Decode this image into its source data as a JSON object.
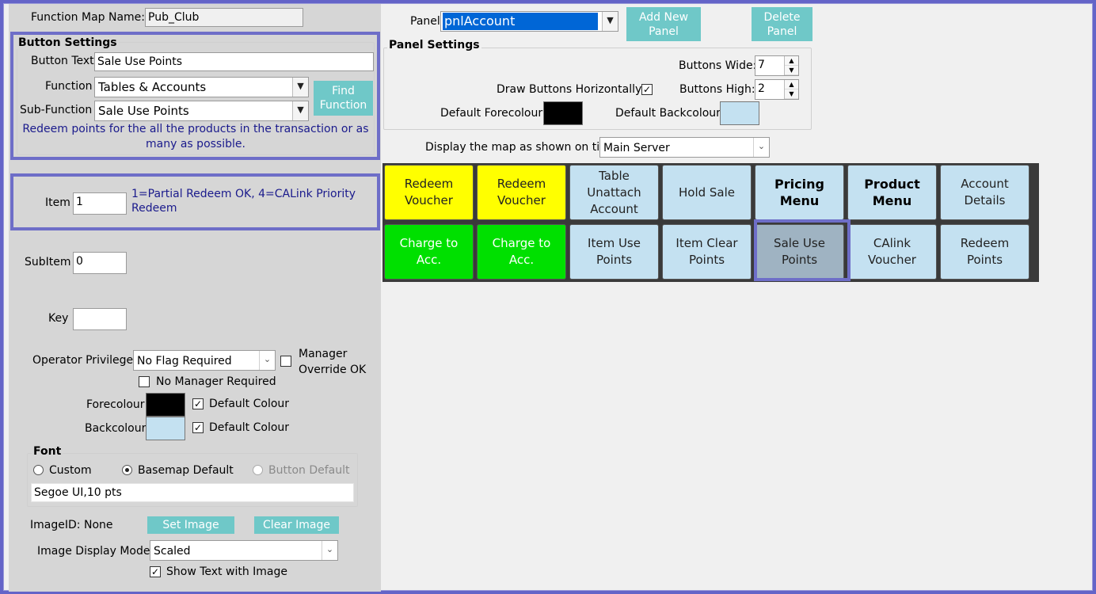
{
  "function_map": {
    "label": "Function Map Name:",
    "value": "Pub_Club"
  },
  "button_settings": {
    "title": "Button Settings",
    "button_text_label": "Button Text",
    "button_text_value": "Sale Use Points",
    "function_label": "Function",
    "function_value": "Tables & Accounts",
    "sub_function_label": "Sub-Function",
    "sub_function_value": "Sale Use Points",
    "find_function_label_1": "Find",
    "find_function_label_2": "Function",
    "description_1": "Redeem points for the all the products in the transaction or as",
    "description_2": "many as possible."
  },
  "item": {
    "label": "Item",
    "value": "1",
    "hint_1": "1=Partial Redeem OK, 4=CALink Priority",
    "hint_2": "Redeem"
  },
  "subitem": {
    "label": "SubItem",
    "value": "0"
  },
  "key": {
    "label": "Key",
    "value": ""
  },
  "operator": {
    "label": "Operator Privilege:",
    "value": "No Flag Required",
    "manager_override_1": "Manager",
    "manager_override_2": "Override OK",
    "no_manager_label": "No Manager Required"
  },
  "colours": {
    "forecolour_label": "Forecolour",
    "backcolour_label": "Backcolour",
    "default_colour_label": "Default Colour",
    "fore_color": "#000000",
    "back_color": "#c4e1f1"
  },
  "font": {
    "title": "Font",
    "custom_label": "Custom",
    "basemap_label": "Basemap Default",
    "button_default_label": "Button Default",
    "value": "Segoe UI,10 pts"
  },
  "image": {
    "id_label": "ImageID:",
    "id_value": "None",
    "set_label": "Set Image",
    "clear_label": "Clear Image",
    "mode_label": "Image Display Mode:",
    "mode_value": "Scaled",
    "show_text_label": "Show Text with Image"
  },
  "panel": {
    "label": "Panel",
    "value": "pnlAccount",
    "add_new_1": "Add New",
    "add_new_2": "Panel",
    "delete_1": "Delete",
    "delete_2": "Panel"
  },
  "panel_settings": {
    "title": "Panel Settings",
    "buttons_wide_label": "Buttons Wide:",
    "buttons_wide_value": "7",
    "buttons_high_label": "Buttons High:",
    "buttons_high_value": "2",
    "draw_horizontal_label": "Draw Buttons Horizontally:",
    "default_fore_label": "Default Forecolour",
    "default_back_label": "Default Backcolour"
  },
  "display_map": {
    "label": "Display the map as shown on till:",
    "value": "Main Server"
  },
  "grid_buttons": [
    {
      "l1": "Redeem",
      "l2": "Voucher",
      "l3": "",
      "style": "yellow"
    },
    {
      "l1": "Redeem",
      "l2": "Voucher",
      "l3": "",
      "style": "yellow"
    },
    {
      "l1": "Table",
      "l2": "Unattach",
      "l3": "Account",
      "style": "blue"
    },
    {
      "l1": "Hold Sale",
      "l2": "",
      "l3": "",
      "style": "blue"
    },
    {
      "l1": "Pricing",
      "l2": "Menu",
      "l3": "",
      "style": "blue bold"
    },
    {
      "l1": "Product",
      "l2": "Menu",
      "l3": "",
      "style": "blue bold"
    },
    {
      "l1": "Account",
      "l2": "Details",
      "l3": "",
      "style": "blue"
    },
    {
      "l1": "Charge to",
      "l2": "Acc.",
      "l3": "",
      "style": "green"
    },
    {
      "l1": "Charge to",
      "l2": "Acc.",
      "l3": "",
      "style": "green"
    },
    {
      "l1": "Item Use",
      "l2": "Points",
      "l3": "",
      "style": "blue"
    },
    {
      "l1": "Item Clear",
      "l2": "Points",
      "l3": "",
      "style": "blue"
    },
    {
      "l1": "Sale Use",
      "l2": "Points",
      "l3": "",
      "style": "blue sel"
    },
    {
      "l1": "CAlink",
      "l2": "Voucher",
      "l3": "",
      "style": "blue"
    },
    {
      "l1": "Redeem",
      "l2": "Points",
      "l3": "",
      "style": "blue"
    }
  ]
}
